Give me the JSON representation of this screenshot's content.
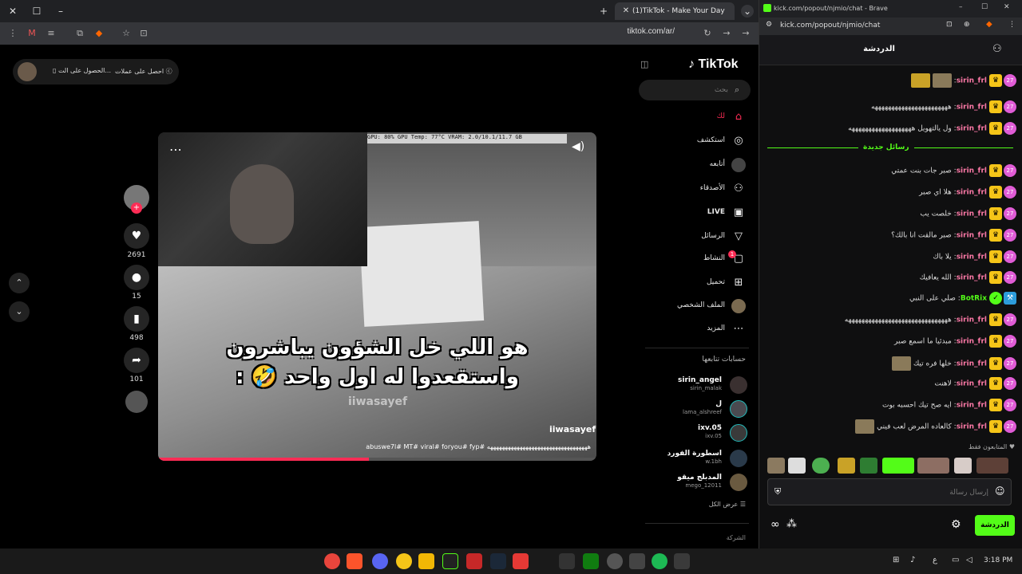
{
  "tiktok_browser": {
    "tab_title": "(1)TikTok - Make Your Day",
    "url": "tiktok.com/ar/"
  },
  "tiktok": {
    "logo": "TikTok",
    "search_placeholder": "بحث",
    "user_pill": {
      "coins": "احصل على عملات",
      "app": "الحصول على الت..."
    },
    "nav": [
      {
        "label": "لك",
        "icon": "home-icon"
      },
      {
        "label": "استكشف",
        "icon": "compass-icon"
      },
      {
        "label": "أتابعه",
        "icon": "following-icon"
      },
      {
        "label": "الأصدقاء",
        "icon": "friends-icon"
      },
      {
        "label": "LIVE",
        "icon": "live-icon"
      },
      {
        "label": "الرسائل",
        "icon": "messages-icon"
      },
      {
        "label": "النشاط",
        "icon": "activity-icon"
      },
      {
        "label": "تحميل",
        "icon": "upload-icon"
      },
      {
        "label": "الملف الشخصي",
        "icon": "profile-icon"
      },
      {
        "label": "المزيد",
        "icon": "more-icon"
      }
    ],
    "activity_badge": "1",
    "following_heading": "حسابات تتابعها",
    "following": [
      {
        "name": "sirin_angel",
        "handle": "sirin_malak"
      },
      {
        "name": "ل",
        "handle": "lama_alshreef"
      },
      {
        "name": "ixv.05",
        "handle": "ixv.05"
      },
      {
        "name": "اسطورة الفورد",
        "handle": "w.1bh"
      },
      {
        "name": "المدبلج ميقو",
        "handle": "mego_12011"
      }
    ],
    "see_all": "عرض الكل",
    "company": "الشركة",
    "video": {
      "hud": "GPU: 80%   GPU Temp: 77°C   VRAM: 2.0/10.1/11.7 GB",
      "caption_line1": "هو اللي خل الشؤون يباشرون",
      "caption_line2": "واستقعدوا له اول واحد 🤣 :",
      "watermark": "iiwasayef",
      "author": "iiwasayef",
      "description": "abuswe7l# MT# viral# foryou# fyp# ههههههههههههههههههههههههههههههههههه",
      "progress": 0.48
    },
    "actions": {
      "likes": "2691",
      "comments": "15",
      "saves": "498",
      "shares": "101"
    }
  },
  "kick_browser": {
    "title": "kick.com/popout/njmio/chat - Brave",
    "url": "kick.com/popout/njmio/chat"
  },
  "kick": {
    "header_title": "الدردشة",
    "new_messages_label": "رسائل جديدة",
    "messages": [
      {
        "user": "sirin_frl",
        "text": "",
        "emotes": true
      },
      {
        "user": "sirin_frl",
        "text": "هههههههههههههههههههههههه"
      },
      {
        "user": "sirin_frl",
        "text": "ول يالتهويل هههههههههههههههههههه"
      },
      {
        "user": "sirin_frl",
        "text": "صبر جات بنت عمتي"
      },
      {
        "user": "sirin_frl",
        "text": "هلا اي صبر"
      },
      {
        "user": "sirin_frl",
        "text": "خلصت يب"
      },
      {
        "user": "sirin_frl",
        "text": "صبر مالقت انا بالك؟"
      },
      {
        "user": "sirin_frl",
        "text": "يلا باك"
      },
      {
        "user": "sirin_frl",
        "text": "الله يعافيك"
      },
      {
        "user": "BotRix",
        "text": "صلي على النبي",
        "bot": true
      },
      {
        "user": "sirin_frl",
        "text": "هههههههههههههههههههههههههههههههه"
      },
      {
        "user": "sirin_frl",
        "text": "مبدئيا ما اسمع صبر"
      },
      {
        "user": "sirin_frl",
        "text": "خلها فره تيك",
        "emote_after": true
      },
      {
        "user": "sirin_frl",
        "text": "لاهنت"
      },
      {
        "user": "sirin_frl",
        "text": "ايه صح تيك احسبه بوت"
      },
      {
        "user": "sirin_frl",
        "text": "كالعاده المرض لعب فيني",
        "emote_after": true
      }
    ],
    "sub_badge": "27",
    "followers_only": "المتابعون فقط",
    "input_placeholder": "إرسال رسالة",
    "send_label": "الدردشة"
  },
  "taskbar": {
    "time": "3:18 PM",
    "language": "ع"
  }
}
